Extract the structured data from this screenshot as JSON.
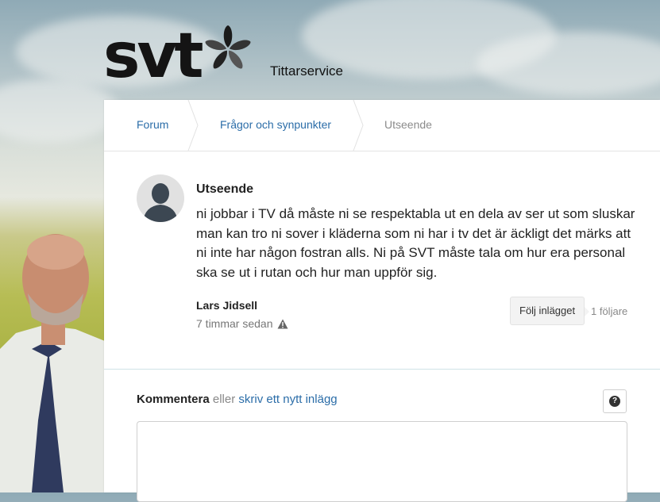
{
  "brand": {
    "logo_text": "svt",
    "subtitle": "Tittarservice"
  },
  "breadcrumb": [
    "Forum",
    "Frågor och synpunkter",
    "Utseende"
  ],
  "post": {
    "title": "Utseende",
    "body": "ni jobbar i TV då måste ni se respektabla ut en dela av ser ut som sluskar man kan tro ni sover i kläderna som ni har i tv det är äckligt det märks att ni inte har någon fostran alls. Ni på SVT måste tala om hur era personal ska se ut i rutan och hur man uppför sig.",
    "author": "Lars Jidsell",
    "time": "7 timmar sedan",
    "follow_label": "Följ inlägget",
    "followers": "1 följare"
  },
  "comment": {
    "label": "Kommentera",
    "or": "eller",
    "new_post": "skriv ett nytt inlägg",
    "help_icon": "?"
  },
  "icons": [
    "svt-flower-icon",
    "user-avatar-icon",
    "warning-icon",
    "help-icon"
  ],
  "colors": {
    "link": "#2b6da8",
    "divider": "#cfe3e7",
    "text": "#222222"
  }
}
